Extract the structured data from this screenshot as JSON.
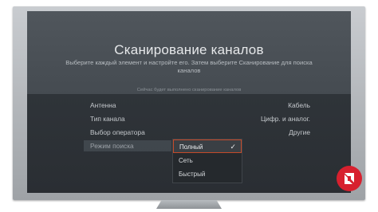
{
  "screen": {
    "title": "Сканирование каналов",
    "subtitle": "Выберите каждый элемент и настройте его. Затем выберите Сканирование для поиска каналов",
    "hint": "Сейчас будет выполнено сканирование каналов"
  },
  "settings": [
    {
      "label": "Антенна",
      "value": "Кабель"
    },
    {
      "label": "Тип канала",
      "value": "Цифр. и аналог."
    },
    {
      "label": "Выбор оператора",
      "value": "Другие"
    },
    {
      "label": "Режим поиска",
      "value": ""
    }
  ],
  "dropdown": {
    "options": [
      "Полный",
      "Сеть",
      "Быстрый"
    ],
    "selected": "Полный"
  },
  "colors": {
    "accent": "#c44a2a",
    "logo": "#d7202e"
  },
  "icons": {
    "check": "check-icon",
    "logo": "logo-icon"
  }
}
